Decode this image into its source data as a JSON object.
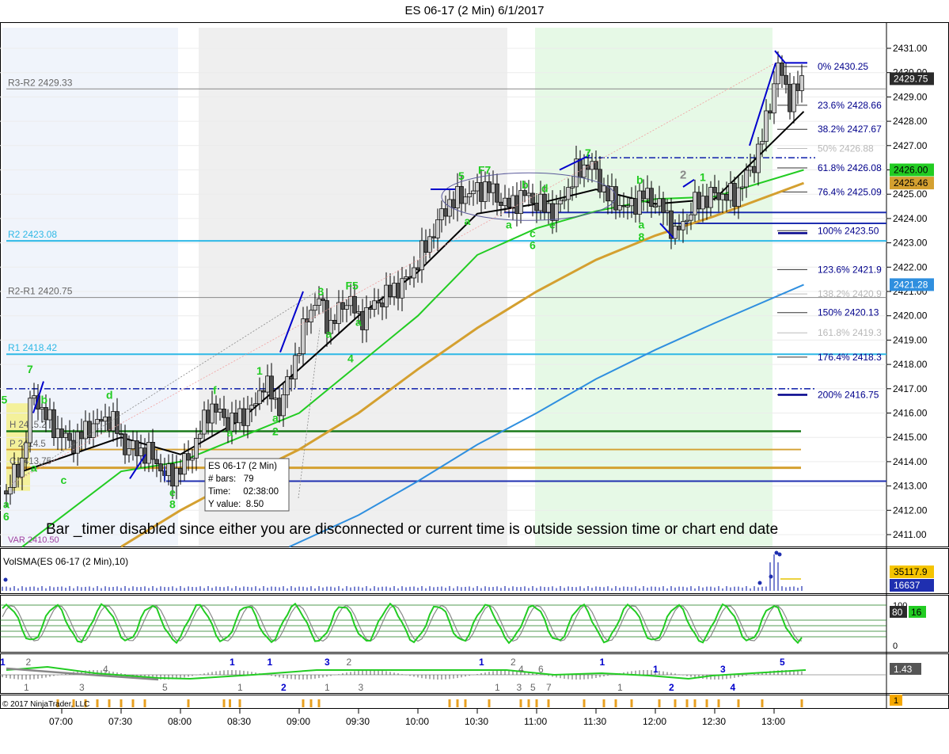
{
  "window": {
    "title": "ES 06-17 (2 Min)  6/1/2017"
  },
  "colors": {
    "up_bar": "#cccccc",
    "down_bar": "#4f4f4f",
    "ema_fast": "#000000",
    "ema_mid": "#22cc22",
    "ema_slow": "#d4a030",
    "ema_long": "#2f8fdf",
    "pivot_line": "#2eb8e6",
    "fib": "#00008b",
    "wave_label": "#22cc22",
    "trend_mark": "#0000cc",
    "shade_green": "#e6f9e6",
    "shade_gray": "#efefef",
    "shade_blue": "#f0f4fb",
    "last_price_box": "#2b2b2b"
  },
  "chart_data": [
    {
      "type": "candlestick",
      "title": "ES 06-17 (2 Min)  6/1/2017",
      "ylim": [
        2410.5,
        2431.6
      ],
      "y_ticks": [
        "2411.00",
        "2412.00",
        "2413.00",
        "2414.00",
        "2415.00",
        "2416.00",
        "2417.00",
        "2418.00",
        "2419.00",
        "2420.00",
        "2421.00",
        "2422.00",
        "2423.00",
        "2424.00",
        "2425.00",
        "2426.00",
        "2427.00",
        "2428.00",
        "2429.00",
        "2430.00",
        "2431.00"
      ],
      "x_ticks": [
        "07:00",
        "07:30",
        "08:00",
        "08:30",
        "09:00",
        "09:30",
        "10:00",
        "10:30",
        "11:00",
        "11:30",
        "12:00",
        "12:30",
        "13:00"
      ],
      "price_path": [
        [
          "06:32",
          2412.8
        ],
        [
          "06:40",
          2414.0
        ],
        [
          "06:45",
          2416.8
        ],
        [
          "06:55",
          2415.5
        ],
        [
          "07:05",
          2414.7
        ],
        [
          "07:15",
          2415.5
        ],
        [
          "07:25",
          2415.8
        ],
        [
          "07:32",
          2414.6
        ],
        [
          "07:45",
          2414.3
        ],
        [
          "07:52",
          2413.5
        ],
        [
          "07:56",
          2413.4
        ],
        [
          "08:05",
          2414.2
        ],
        [
          "08:15",
          2416.3
        ],
        [
          "08:25",
          2415.6
        ],
        [
          "08:37",
          2416.2
        ],
        [
          "08:42",
          2417.3
        ],
        [
          "08:50",
          2416.2
        ],
        [
          "08:55",
          2417.4
        ],
        [
          "09:05",
          2420.2
        ],
        [
          "09:10",
          2420.7
        ],
        [
          "09:15",
          2419.5
        ],
        [
          "09:25",
          2420.8
        ],
        [
          "09:30",
          2419.8
        ],
        [
          "09:40",
          2420.6
        ],
        [
          "09:55",
          2421.5
        ],
        [
          "10:05",
          2423.0
        ],
        [
          "10:15",
          2424.6
        ],
        [
          "10:25",
          2425.0
        ],
        [
          "10:35",
          2425.3
        ],
        [
          "10:45",
          2424.5
        ],
        [
          "10:55",
          2425.0
        ],
        [
          "11:00",
          2424.6
        ],
        [
          "11:10",
          2424.3
        ],
        [
          "11:20",
          2425.9
        ],
        [
          "11:27",
          2426.3
        ],
        [
          "11:35",
          2425.0
        ],
        [
          "11:45",
          2424.4
        ],
        [
          "11:55",
          2425.0
        ],
        [
          "12:05",
          2424.3
        ],
        [
          "12:10",
          2423.3
        ],
        [
          "12:20",
          2424.6
        ],
        [
          "12:30",
          2425.0
        ],
        [
          "12:40",
          2424.9
        ],
        [
          "12:50",
          2426.3
        ],
        [
          "12:55",
          2427.6
        ],
        [
          "13:02",
          2430.3
        ],
        [
          "13:08",
          2428.9
        ],
        [
          "13:15",
          2429.75
        ]
      ],
      "moving_averages": [
        {
          "name": "fast",
          "points": [
            [
              "06:40",
              2413.6
            ],
            [
              "07:30",
              2415.0
            ],
            [
              "08:00",
              2414.3
            ],
            [
              "08:30",
              2415.7
            ],
            [
              "09:00",
              2417.8
            ],
            [
              "09:30",
              2420.0
            ],
            [
              "10:00",
              2421.8
            ],
            [
              "10:30",
              2424.2
            ],
            [
              "11:00",
              2424.6
            ],
            [
              "11:30",
              2425.2
            ],
            [
              "12:00",
              2424.6
            ],
            [
              "12:30",
              2424.8
            ],
            [
              "13:15",
              2428.4
            ]
          ]
        },
        {
          "name": "mid",
          "points": [
            [
              "06:40",
              2410.5
            ],
            [
              "07:30",
              2413.6
            ],
            [
              "08:00",
              2414.0
            ],
            [
              "08:30",
              2415.0
            ],
            [
              "09:00",
              2416.0
            ],
            [
              "09:30",
              2418.0
            ],
            [
              "10:00",
              2420.0
            ],
            [
              "10:30",
              2422.5
            ],
            [
              "11:00",
              2423.6
            ],
            [
              "11:30",
              2424.3
            ],
            [
              "12:00",
              2424.8
            ],
            [
              "12:30",
              2424.9
            ],
            [
              "13:15",
              2426.0
            ]
          ]
        },
        {
          "name": "slow",
          "points": [
            [
              "07:30",
              2410.5
            ],
            [
              "08:00",
              2412.0
            ],
            [
              "08:30",
              2413.3
            ],
            [
              "09:00",
              2414.5
            ],
            [
              "09:30",
              2416.0
            ],
            [
              "10:00",
              2417.8
            ],
            [
              "10:30",
              2419.5
            ],
            [
              "11:00",
              2421.0
            ],
            [
              "11:30",
              2422.3
            ],
            [
              "12:00",
              2423.3
            ],
            [
              "12:30",
              2424.1
            ],
            [
              "13:15",
              2425.46
            ]
          ]
        },
        {
          "name": "long",
          "points": [
            [
              "08:55",
              2410.5
            ],
            [
              "09:30",
              2411.8
            ],
            [
              "10:00",
              2413.2
            ],
            [
              "10:30",
              2414.7
            ],
            [
              "11:00",
              2416.0
            ],
            [
              "11:30",
              2417.4
            ],
            [
              "12:00",
              2418.6
            ],
            [
              "12:30",
              2419.7
            ],
            [
              "13:15",
              2421.28
            ]
          ]
        }
      ],
      "levels": [
        {
          "label": "R3-R2 2429.33",
          "price": 2429.33,
          "kind": "mid"
        },
        {
          "label": "R2 2423.08",
          "price": 2423.08,
          "kind": "pivot"
        },
        {
          "label": "R2-R1 2420.75",
          "price": 2420.75,
          "kind": "mid"
        },
        {
          "label": "R1 2418.42",
          "price": 2418.42,
          "kind": "pivot"
        }
      ],
      "overlap_labels": [
        "H 2415.2",
        "P 2414.5",
        "C 2413.75"
      ],
      "horizontal_lines": [
        {
          "price": 2415.25,
          "kind": "dark_green"
        },
        {
          "price": 2414.5,
          "kind": "gold"
        },
        {
          "price": 2413.75,
          "kind": "gold_thick"
        },
        {
          "price": 2413.2,
          "kind": "navy"
        },
        {
          "price": 2424.25,
          "kind": "navy"
        },
        {
          "price": 2423.8,
          "kind": "navy"
        }
      ],
      "fib_levels": [
        {
          "label": "0%  2430.25",
          "price": 2430.25,
          "faded": false
        },
        {
          "label": "23.6%  2428.66",
          "price": 2428.66,
          "faded": false
        },
        {
          "label": "38.2%  2427.67",
          "price": 2427.67,
          "faded": false
        },
        {
          "label": "50%  2426.88",
          "price": 2426.88,
          "faded": true
        },
        {
          "label": "61.8%  2426.08",
          "price": 2426.08,
          "faded": false
        },
        {
          "label": "76.4%  2425.09",
          "price": 2425.09,
          "faded": false
        },
        {
          "label": "100%  2423.50",
          "price": 2423.5,
          "faded": false
        },
        {
          "label": "123.6%  2421.9",
          "price": 2421.9,
          "faded": false
        },
        {
          "label": "138.2%  2420.9",
          "price": 2420.9,
          "faded": true
        },
        {
          "label": "150%  2420.13",
          "price": 2420.13,
          "faded": false
        },
        {
          "label": "161.8%  2419.3",
          "price": 2419.3,
          "faded": true
        },
        {
          "label": "176.4%  2418.3",
          "price": 2418.3,
          "faded": false
        },
        {
          "label": "200%  2416.75",
          "price": 2416.75,
          "faded": false
        }
      ],
      "price_labels": [
        {
          "text": "2429.75",
          "price": 2429.75,
          "bg": "#2b2b2b",
          "fg": "#ffffff"
        },
        {
          "text": "2426.00",
          "price": 2426.0,
          "bg": "#22cc22",
          "fg": "#000000"
        },
        {
          "text": "2425.46",
          "price": 2425.46,
          "bg": "#d4a030",
          "fg": "#000000"
        },
        {
          "text": "2421.28",
          "price": 2421.28,
          "bg": "#2f8fdf",
          "fg": "#ffffff"
        }
      ],
      "wave_labels": [
        {
          "text": "5",
          "time": "06:31",
          "price": 2416.55
        },
        {
          "text": "7",
          "time": "06:44",
          "price": 2417.8
        },
        {
          "text": "b",
          "time": "06:51",
          "price": 2416.55
        },
        {
          "text": "d",
          "time": "07:24",
          "price": 2416.75
        },
        {
          "text": "a",
          "time": "06:32",
          "price": 2412.25
        },
        {
          "text": "6",
          "time": "06:32",
          "price": 2411.75
        },
        {
          "text": "a",
          "time": "06:46",
          "price": 2413.75
        },
        {
          "text": "c",
          "time": "07:01",
          "price": 2413.25
        },
        {
          "text": "e",
          "time": "07:56",
          "price": 2412.75
        },
        {
          "text": "8",
          "time": "07:56",
          "price": 2412.25
        },
        {
          "text": "f",
          "time": "08:18",
          "price": 2416.95
        },
        {
          "text": "1",
          "time": "08:40",
          "price": 2417.75
        },
        {
          "text": "a",
          "time": "08:48",
          "price": 2415.8
        },
        {
          "text": "2",
          "time": "08:48",
          "price": 2415.25
        },
        {
          "text": "a",
          "time": "08:25",
          "price": 2415.2
        },
        {
          "text": "3",
          "time": "09:11",
          "price": 2421.0
        },
        {
          "text": "F5",
          "time": "09:25",
          "price": 2421.25
        },
        {
          "text": "a",
          "time": "09:15",
          "price": 2419.25
        },
        {
          "text": "a",
          "time": "09:30",
          "price": 2419.75
        },
        {
          "text": "4",
          "time": "09:26",
          "price": 2418.25
        },
        {
          "text": "5",
          "time": "10:22",
          "price": 2425.75
        },
        {
          "text": "F7",
          "time": "10:32",
          "price": 2426.0
        },
        {
          "text": "a",
          "time": "10:25",
          "price": 2423.9
        },
        {
          "text": "a",
          "time": "10:46",
          "price": 2423.75
        },
        {
          "text": "b",
          "time": "10:54",
          "price": 2425.4
        },
        {
          "text": "d",
          "time": "11:04",
          "price": 2425.25
        },
        {
          "text": "c",
          "time": "10:58",
          "price": 2423.4
        },
        {
          "text": "e",
          "time": "11:08",
          "price": 2423.75
        },
        {
          "text": "6",
          "time": "10:58",
          "price": 2422.9
        },
        {
          "text": "7",
          "time": "11:26",
          "price": 2426.7
        },
        {
          "text": "b",
          "time": "11:52",
          "price": 2425.6
        },
        {
          "text": "a",
          "time": "11:53",
          "price": 2423.75
        },
        {
          "text": "8",
          "time": "11:53",
          "price": 2423.25
        },
        {
          "text": "1",
          "time": "12:24",
          "price": 2425.7
        }
      ],
      "gray_labels": [
        {
          "text": "2",
          "time": "12:14",
          "price": 2425.8
        }
      ],
      "info_box": {
        "lines": [
          "ES 06-17 (2 Min)",
          "# bars:   79",
          "Time:     02:38:00",
          "Y value:  8.50"
        ]
      },
      "message": "Bar _timer disabled since either you are disconnected or current time is outside session time or chart end date",
      "var_label": "VAR 2410.50"
    },
    {
      "type": "bar",
      "title": "VolSMA(ES 06-17 (2 Min),10)",
      "value_labels": [
        "35117.9",
        "16637"
      ],
      "volume_profile": "low baseline with spikes at 12:58-13:02"
    },
    {
      "type": "line",
      "title": "",
      "y_ticks": [
        "100",
        "0"
      ],
      "value_labels": [
        "80",
        "16"
      ]
    },
    {
      "type": "bar",
      "title": "",
      "value_label": "1.43",
      "count_labels": [
        {
          "text": "1",
          "time": "06:30",
          "row": "top",
          "color": "blue"
        },
        {
          "text": "2",
          "time": "06:43",
          "row": "top",
          "color": "gray"
        },
        {
          "text": "1",
          "time": "06:42",
          "row": "bottom",
          "color": "gray"
        },
        {
          "text": "3",
          "time": "07:10",
          "row": "bottom",
          "color": "gray"
        },
        {
          "text": "4",
          "time": "07:22",
          "row": "mid",
          "color": "gray"
        },
        {
          "text": "5",
          "time": "07:52",
          "row": "bottom",
          "color": "gray"
        },
        {
          "text": "1",
          "time": "08:26",
          "row": "top",
          "color": "blue"
        },
        {
          "text": "1",
          "time": "08:30",
          "row": "bottom",
          "color": "gray"
        },
        {
          "text": "1",
          "time": "08:45",
          "row": "top",
          "color": "blue"
        },
        {
          "text": "2",
          "time": "08:52",
          "row": "bottom",
          "color": "blue"
        },
        {
          "text": "3",
          "time": "09:14",
          "row": "top",
          "color": "blue"
        },
        {
          "text": "2",
          "time": "09:25",
          "row": "top",
          "color": "gray"
        },
        {
          "text": "1",
          "time": "09:14",
          "row": "bottom",
          "color": "gray"
        },
        {
          "text": "3",
          "time": "09:31",
          "row": "bottom",
          "color": "gray"
        },
        {
          "text": "1",
          "time": "10:32",
          "row": "top",
          "color": "blue"
        },
        {
          "text": "2",
          "time": "10:48",
          "row": "top",
          "color": "gray"
        },
        {
          "text": "1",
          "time": "10:40",
          "row": "bottom",
          "color": "gray"
        },
        {
          "text": "3",
          "time": "10:51",
          "row": "bottom",
          "color": "gray"
        },
        {
          "text": "4",
          "time": "10:52",
          "row": "mid",
          "color": "gray"
        },
        {
          "text": "5",
          "time": "10:58",
          "row": "bottom",
          "color": "gray"
        },
        {
          "text": "6",
          "time": "11:02",
          "row": "mid",
          "color": "gray"
        },
        {
          "text": "7",
          "time": "11:06",
          "row": "bottom",
          "color": "gray"
        },
        {
          "text": "1",
          "time": "11:33",
          "row": "top",
          "color": "blue"
        },
        {
          "text": "1",
          "time": "11:42",
          "row": "bottom",
          "color": "gray"
        },
        {
          "text": "1",
          "time": "12:00",
          "row": "mid",
          "color": "blue"
        },
        {
          "text": "2",
          "time": "12:08",
          "row": "bottom",
          "color": "blue"
        },
        {
          "text": "3",
          "time": "12:34",
          "row": "mid",
          "color": "blue"
        },
        {
          "text": "4",
          "time": "12:39",
          "row": "bottom",
          "color": "blue"
        },
        {
          "text": "5",
          "time": "13:04",
          "row": "top",
          "color": "blue"
        }
      ]
    },
    {
      "type": "bar",
      "title": "",
      "value_label": "1",
      "tick_times": [
        "06:58",
        "07:06",
        "07:12",
        "07:18",
        "07:24",
        "07:30",
        "07:36",
        "07:42",
        "08:04",
        "08:22",
        "08:25",
        "08:30",
        "09:02",
        "09:06",
        "09:10",
        "10:16",
        "10:20",
        "10:24",
        "10:36",
        "10:52",
        "10:56",
        "11:00",
        "11:06",
        "11:24",
        "11:34",
        "11:40",
        "11:48",
        "12:02",
        "12:10",
        "12:16",
        "12:20",
        "12:26",
        "12:32",
        "12:42",
        "12:54",
        "13:14"
      ]
    }
  ],
  "footer": {
    "copyright": "© 2017 NinjaTrader, LLC"
  }
}
